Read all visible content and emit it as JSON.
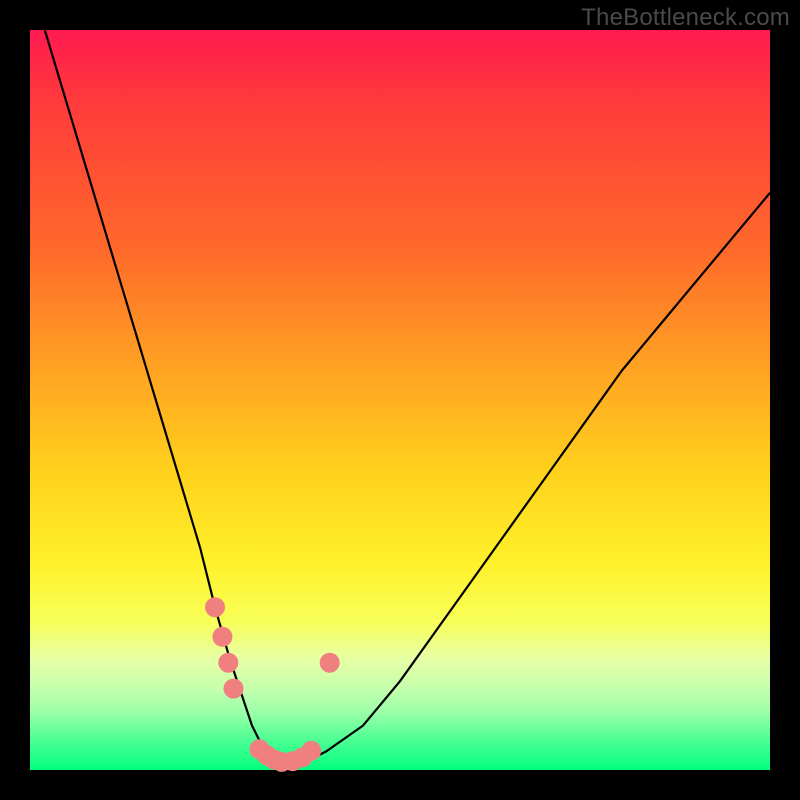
{
  "watermark": "TheBottleneck.com",
  "colors": {
    "frame": "#000000",
    "curve": "#000000",
    "marker": "#f08080",
    "gradient_stops": [
      {
        "pos": 0.0,
        "hex": "#ff1a4f"
      },
      {
        "pos": 0.1,
        "hex": "#ff3b3b"
      },
      {
        "pos": 0.3,
        "hex": "#ff6a2a"
      },
      {
        "pos": 0.45,
        "hex": "#ffa023"
      },
      {
        "pos": 0.6,
        "hex": "#ffd21c"
      },
      {
        "pos": 0.72,
        "hex": "#fff12a"
      },
      {
        "pos": 0.8,
        "hex": "#f8ff5a"
      },
      {
        "pos": 0.85,
        "hex": "#e6ffa5"
      },
      {
        "pos": 0.89,
        "hex": "#c5ffac"
      },
      {
        "pos": 0.92,
        "hex": "#9effa9"
      },
      {
        "pos": 0.95,
        "hex": "#60ff99"
      },
      {
        "pos": 1.0,
        "hex": "#00ff7e"
      }
    ]
  },
  "chart_data": {
    "type": "line",
    "title": "",
    "xlabel": "",
    "ylabel": "",
    "xlim": [
      0,
      100
    ],
    "ylim": [
      0,
      100
    ],
    "series": [
      {
        "name": "bottleneck-curve",
        "x": [
          2,
          5,
          8,
          11,
          14,
          17,
          20,
          23,
          25,
          27,
          29,
          30,
          31,
          32,
          33,
          34,
          36,
          38,
          40,
          45,
          50,
          55,
          60,
          65,
          70,
          75,
          80,
          85,
          90,
          95,
          100
        ],
        "y": [
          100,
          90,
          80,
          70,
          60,
          50,
          40,
          30,
          22,
          15,
          9,
          6,
          4,
          2.5,
          1.5,
          1,
          1,
          1.5,
          2.5,
          6,
          12,
          19,
          26,
          33,
          40,
          47,
          54,
          60,
          66,
          72,
          78
        ]
      }
    ],
    "markers": [
      {
        "name": "left-cluster",
        "points": [
          {
            "x": 25,
            "y": 22
          },
          {
            "x": 26,
            "y": 18
          },
          {
            "x": 26.8,
            "y": 14.5
          },
          {
            "x": 27.5,
            "y": 11
          }
        ]
      },
      {
        "name": "valley-floor",
        "points": [
          {
            "x": 31,
            "y": 2.8
          },
          {
            "x": 32,
            "y": 2.0
          },
          {
            "x": 33,
            "y": 1.4
          },
          {
            "x": 34,
            "y": 1.1
          },
          {
            "x": 35.5,
            "y": 1.2
          },
          {
            "x": 36.8,
            "y": 1.7
          },
          {
            "x": 38,
            "y": 2.6
          }
        ]
      },
      {
        "name": "right-top-dot",
        "points": [
          {
            "x": 40.5,
            "y": 14.5
          }
        ]
      }
    ],
    "marker_radius_px": 10
  }
}
